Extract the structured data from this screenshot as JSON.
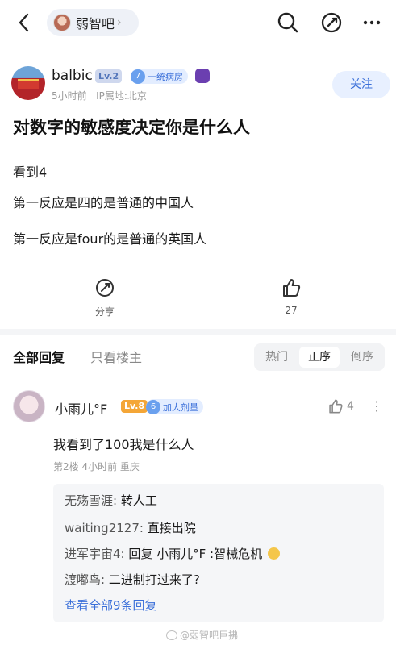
{
  "header": {
    "forum_name": "弱智吧",
    "forum_chevron": "›"
  },
  "post": {
    "author": "balbic",
    "level": "Lv.2",
    "badge_num": "7",
    "badge_label": "一统病房",
    "time": "5小时前",
    "ip": "IP属地:北京",
    "follow_label": "关注",
    "title": "对数字的敏感度决定你是什么人",
    "lines": [
      "看到4",
      "第一反应是四的是普通的中国人",
      "第一反应是four的是普通的英国人"
    ],
    "share_label": "分享",
    "like_count": "27"
  },
  "tabs": {
    "all": "全部回复",
    "op_only": "只看楼主",
    "sort": [
      "热门",
      "正序",
      "倒序"
    ],
    "active_sort": "正序"
  },
  "reply": {
    "user": "小雨儿°F",
    "level": "Lv.8",
    "badge_num": "6",
    "badge_label": "加大剂量",
    "likes": "4",
    "text": "我看到了100我是什么人",
    "meta": "第2楼  4小时前  重庆",
    "subs": [
      {
        "user": "无殇雪涯:",
        "text": "转人工"
      },
      {
        "user": "waiting2127:",
        "text": "直接出院"
      },
      {
        "user": "进军宇宙4:",
        "text": "回复 小雨儿°F :智械危机"
      },
      {
        "user": "渡嘟鸟:",
        "text": "二进制打过来了?"
      }
    ],
    "view_all": "查看全部9条回复"
  },
  "watermark": "@弱智吧巨拂",
  "colors": {
    "accent": "#3a6fd9",
    "level8": "#f4a637"
  }
}
